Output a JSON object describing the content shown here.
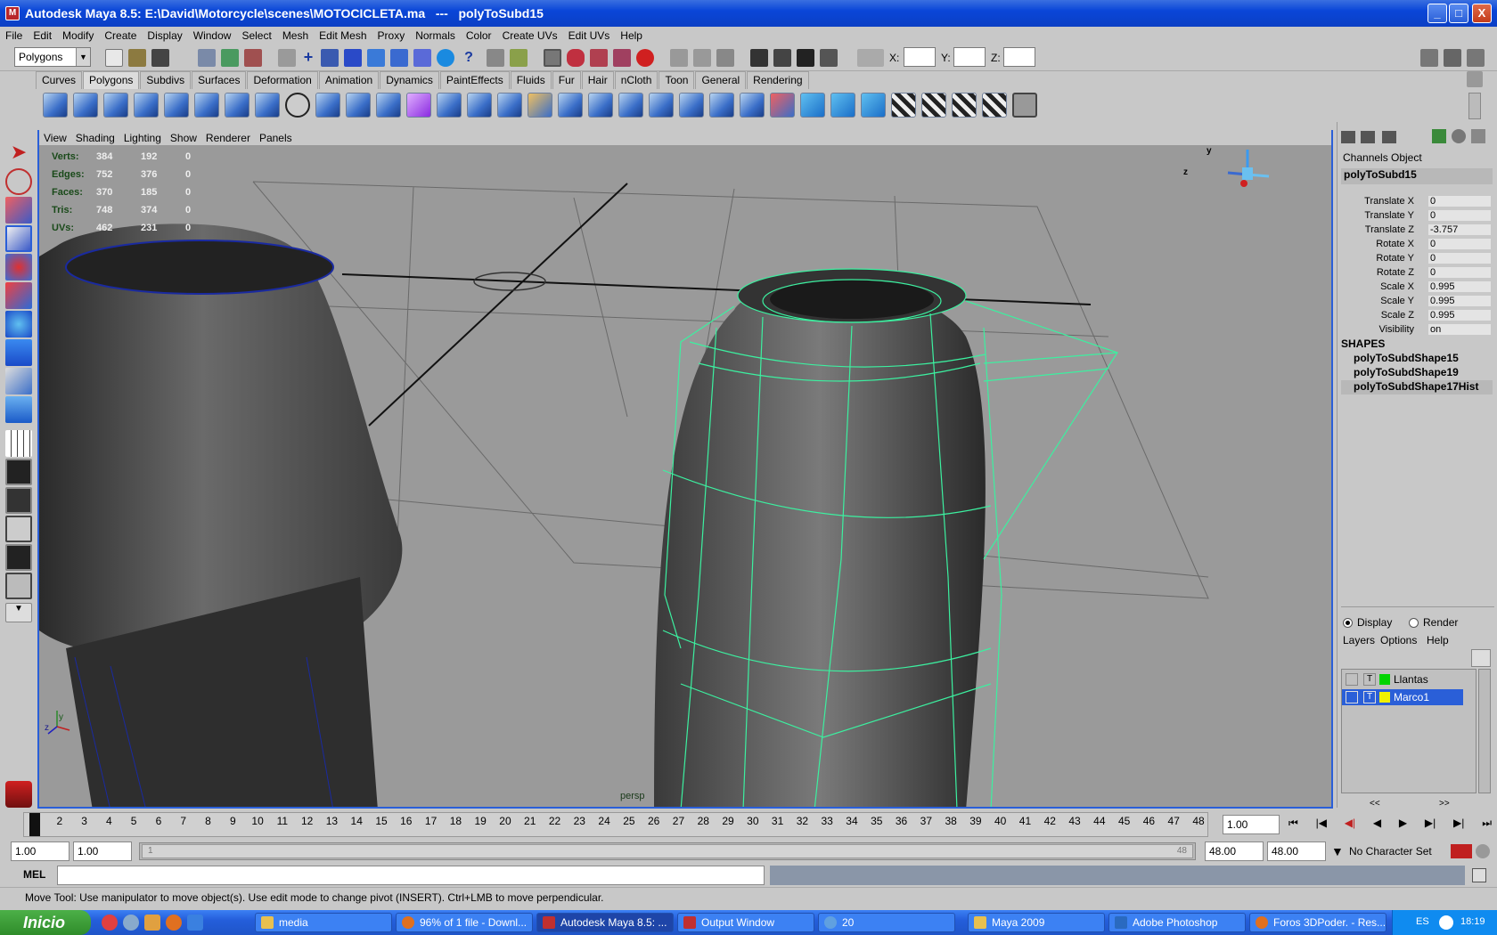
{
  "window": {
    "title": "Autodesk Maya 8.5: E:\\David\\Motorcycle\\scenes\\MOTOCICLETA.ma   ---   polyToSubd15",
    "minimize": "_",
    "maximize": "□",
    "close": "X"
  },
  "menubar": [
    "File",
    "Edit",
    "Modify",
    "Create",
    "Display",
    "Window",
    "Select",
    "Mesh",
    "Edit Mesh",
    "Proxy",
    "Normals",
    "Color",
    "Create UVs",
    "Edit UVs",
    "Help"
  ],
  "toolbar": {
    "mode_select": "Polygons",
    "x_label": "X:",
    "y_label": "Y:",
    "z_label": "Z:"
  },
  "shelf_tabs": [
    "Curves",
    "Polygons",
    "Subdivs",
    "Surfaces",
    "Deformation",
    "Animation",
    "Dynamics",
    "PaintEffects",
    "Fluids",
    "Fur",
    "Hair",
    "nCloth",
    "Toon",
    "General",
    "Rendering"
  ],
  "shelf_active": "Polygons",
  "panel_menu": [
    "View",
    "Shading",
    "Lighting",
    "Show",
    "Renderer",
    "Panels"
  ],
  "hud": [
    {
      "label": "Verts:",
      "a": "384",
      "b": "192",
      "c": "0"
    },
    {
      "label": "Edges:",
      "a": "752",
      "b": "376",
      "c": "0"
    },
    {
      "label": "Faces:",
      "a": "370",
      "b": "185",
      "c": "0"
    },
    {
      "label": "Tris:",
      "a": "748",
      "b": "374",
      "c": "0"
    },
    {
      "label": "UVs:",
      "a": "462",
      "b": "231",
      "c": "0"
    }
  ],
  "viewport": {
    "camera_label": "persp",
    "axis_y": "y",
    "axis_z": "z",
    "axis_y2": "y",
    "axis_z2": "z"
  },
  "channel_box": {
    "tabs": [
      "Channels",
      "Object"
    ],
    "node": "polyToSubd15",
    "attrs": [
      {
        "name": "Translate X",
        "value": "0"
      },
      {
        "name": "Translate Y",
        "value": "0"
      },
      {
        "name": "Translate Z",
        "value": "-3.757"
      },
      {
        "name": "Rotate X",
        "value": "0"
      },
      {
        "name": "Rotate Y",
        "value": "0"
      },
      {
        "name": "Rotate Z",
        "value": "0"
      },
      {
        "name": "Scale X",
        "value": "0.995"
      },
      {
        "name": "Scale Y",
        "value": "0.995"
      },
      {
        "name": "Scale Z",
        "value": "0.995"
      },
      {
        "name": "Visibility",
        "value": "on"
      }
    ],
    "shapes_header": "SHAPES",
    "shapes": [
      "polyToSubdShape15",
      "polyToSubdShape19",
      "polyToSubdShape17Hist"
    ]
  },
  "layer_editor": {
    "display_label": "Display",
    "render_label": "Render",
    "menu": [
      "Layers",
      "Options",
      "Help"
    ],
    "layers": [
      {
        "type": "T",
        "name": "Llantas",
        "color": "#00d400",
        "selected": false
      },
      {
        "type": "T",
        "name": "Marco1",
        "color": "#f0f000",
        "selected": true
      }
    ],
    "scroll_left": "<<",
    "scroll_right": ">>"
  },
  "timeline": {
    "frames": [
      "1",
      "2",
      "3",
      "4",
      "5",
      "6",
      "7",
      "8",
      "9",
      "10",
      "11",
      "12",
      "13",
      "14",
      "15",
      "16",
      "17",
      "18",
      "19",
      "20",
      "21",
      "22",
      "23",
      "24",
      "25",
      "26",
      "27",
      "28",
      "29",
      "30",
      "31",
      "32",
      "33",
      "34",
      "35",
      "36",
      "37",
      "38",
      "39",
      "40",
      "41",
      "42",
      "43",
      "44",
      "45",
      "46",
      "47",
      "48"
    ],
    "current_frame": "1.00"
  },
  "range": {
    "start": "1.00",
    "start2": "1.00",
    "slider_left": "1",
    "slider_right": "48",
    "end": "48.00",
    "end2": "48.00",
    "character_set": "No Character Set"
  },
  "mel": {
    "label": "MEL"
  },
  "help_line": "Move Tool: Use manipulator to move object(s). Use edit mode to change pivot (INSERT).  Ctrl+LMB to move perpendicular.",
  "taskbar": {
    "start": "Inicio",
    "tasks": [
      {
        "label": "media",
        "active": false
      },
      {
        "label": "96% of 1 file - Downl...",
        "active": false
      },
      {
        "label": "Autodesk Maya 8.5: ...",
        "active": true
      },
      {
        "label": "Output Window",
        "active": false
      },
      {
        "label": "20",
        "active": false
      },
      {
        "label": "Maya 2009",
        "active": false
      },
      {
        "label": "Adobe Photoshop",
        "active": false
      },
      {
        "label": "Foros 3DPoder. - Res...",
        "active": false
      }
    ],
    "lang": "ES",
    "clock": "18:19"
  },
  "colors": {
    "wireframe": "#3cf0a0",
    "selection": "#2a5fd8",
    "viewport_bg": "#9a9a9a"
  }
}
